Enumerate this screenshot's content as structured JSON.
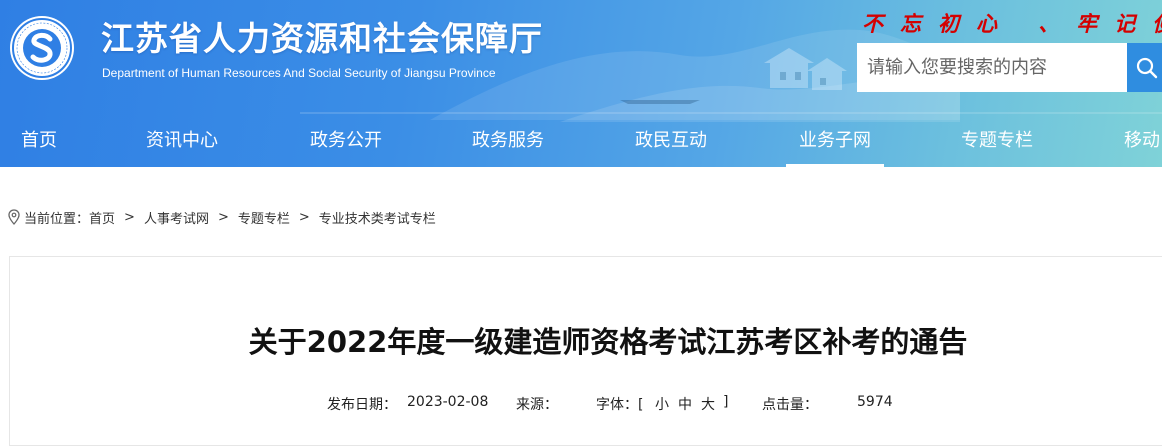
{
  "header": {
    "title": "江苏省人力资源和社会保障厅",
    "subtitle": "Department of Human Resources And Social Security of Jiangsu Province",
    "slogan": "不忘初心 、牢记使"
  },
  "search": {
    "placeholder": "请输入您要搜索的内容",
    "icon": "search-icon"
  },
  "nav": {
    "items": [
      {
        "label": "首页"
      },
      {
        "label": "资讯中心"
      },
      {
        "label": "政务公开"
      },
      {
        "label": "政务服务"
      },
      {
        "label": "政民互动"
      },
      {
        "label": "业务子网"
      },
      {
        "label": "专题专栏"
      },
      {
        "label": "移动"
      }
    ],
    "active_index": 5
  },
  "breadcrumb": {
    "prefix": "当前位置：",
    "items": [
      "首页",
      "人事考试网",
      "专题专栏",
      "专业技术类考试专栏"
    ],
    "separator": ">"
  },
  "article": {
    "title": "关于2022年度一级建造师资格考试江苏考区补考的通告",
    "date_label": "发布日期：",
    "date": "2023-02-08",
    "source_label": "来源：",
    "font_label": "字体：[",
    "font_small": "小",
    "font_medium": "中",
    "font_large": "大",
    "font_close": "]",
    "views_label": "点击量：",
    "views": "5974"
  },
  "colors": {
    "banner_start": "#2f7fe4",
    "banner_end": "#7fd2d8",
    "slogan": "#d40000",
    "search_button": "#2f8de0"
  }
}
